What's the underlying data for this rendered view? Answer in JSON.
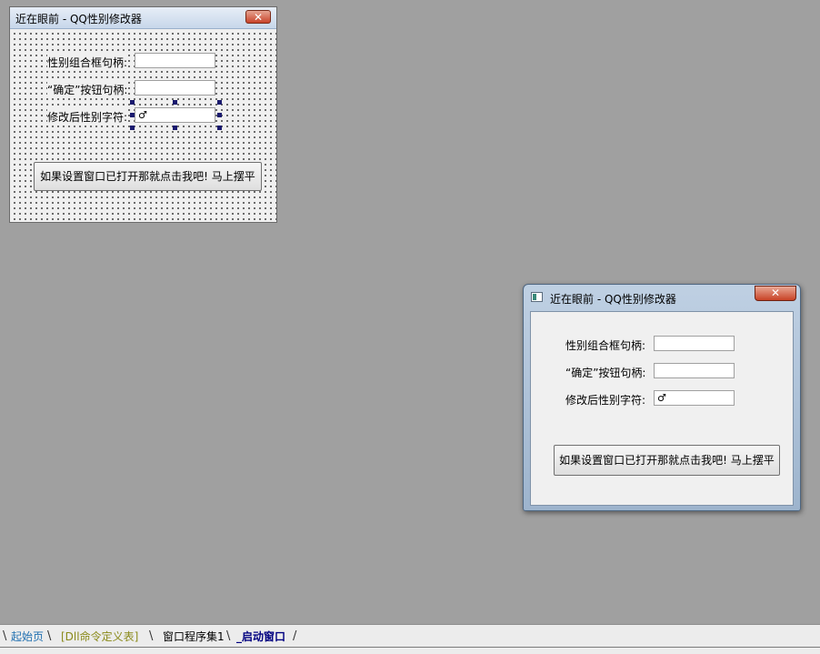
{
  "design_window": {
    "title": "近在眼前 - QQ性别修改器",
    "close_glyph": "✕",
    "label_combo": "性别组合框句柄:",
    "label_confirm": "“确定”按钮句柄:",
    "label_gender_char": "修改后性别字符:",
    "combo_value": "",
    "confirm_value": "",
    "gender_char_value": "♂",
    "action_button": "如果设置窗口已打开那就点击我吧! 马上摆平"
  },
  "run_window": {
    "title": "近在眼前 - QQ性别修改器",
    "close_glyph": "✕",
    "label_combo": "性别组合框句柄:",
    "label_confirm": "“确定”按钮句柄:",
    "label_gender_char": "修改后性别字符:",
    "combo_value": "",
    "confirm_value": "",
    "gender_char_value": "♂",
    "action_button": "如果设置窗口已打开那就点击我吧! 马上摆平"
  },
  "tabs": [
    {
      "label": "起始页",
      "color": "#1f6fb0",
      "active": false
    },
    {
      "label": "[Dll命令定义表]",
      "color": "#8a8a1a",
      "active": false
    },
    {
      "label": "窗口程序集1",
      "color": "#000000",
      "active": false
    },
    {
      "label": "_启动窗口",
      "color": "#000080",
      "active": true
    }
  ],
  "colors": {
    "desktop": "#a0a0a0",
    "close_button": "#c8432a",
    "selection_handle": "#1a1a6e"
  }
}
